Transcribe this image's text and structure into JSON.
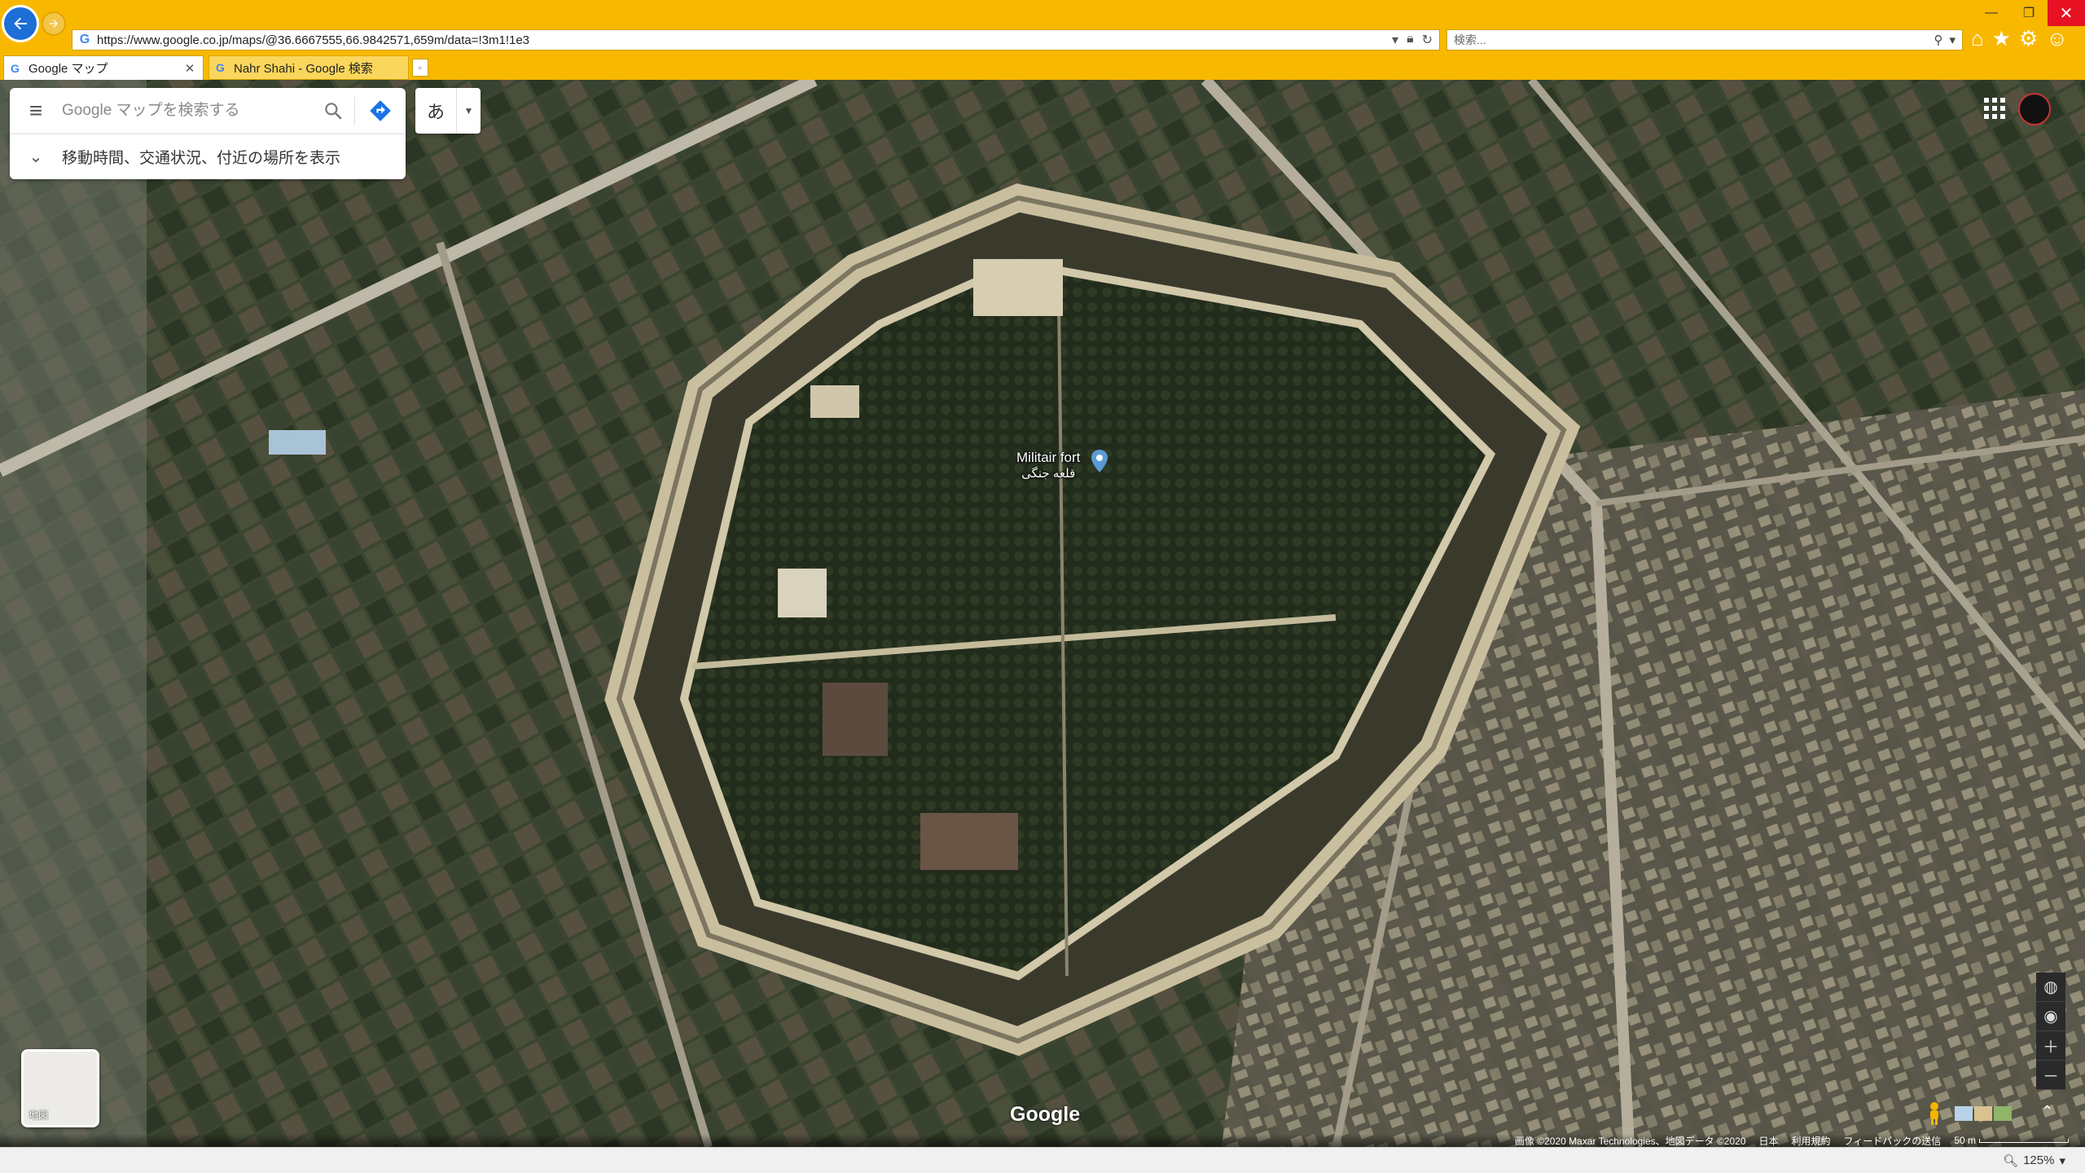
{
  "browser": {
    "url": "https://www.google.co.jp/maps/@36.6667555,66.9842571,659m/data=!3m1!1e3",
    "search_placeholder": "検索...",
    "tabs": [
      {
        "title": "Google マップ",
        "active": true
      },
      {
        "title": "Nahr Shahi - Google 検索",
        "active": false
      }
    ],
    "accent_color": "#f9b800",
    "zoom": "125%"
  },
  "maps": {
    "search_placeholder": "Google マップを検索する",
    "expander_text": "移動時間、交通状況、付近の場所を表示",
    "ime_char": "あ",
    "place_label_en": "Militair fort",
    "place_label_local": "قلعه جنگی",
    "layer_label": "地図",
    "logo": "Google",
    "footer": {
      "imagery": "画像 ©2020 Maxar Technologies、地図データ ©2020",
      "region": "日本",
      "terms": "利用規約",
      "feedback": "フィードバックの送信",
      "scale": "50 m"
    }
  },
  "icons": [
    "back-arrow-icon",
    "forward-arrow-icon",
    "lock-icon",
    "refresh-icon",
    "search-icon",
    "home-icon",
    "star-icon",
    "gear-icon",
    "smiley-icon",
    "hamburger-icon",
    "directions-icon",
    "chevron-down-icon",
    "apps-grid-icon",
    "location-pin-icon",
    "globe-icon",
    "compass-icon",
    "plus-icon",
    "minus-icon",
    "pegman-icon"
  ]
}
